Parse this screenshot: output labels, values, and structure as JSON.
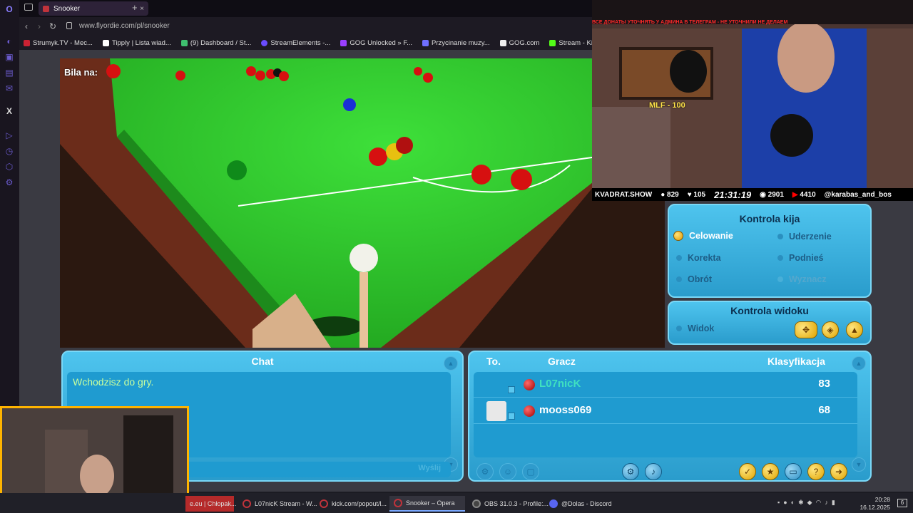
{
  "browser": {
    "tab_title": "Snooker",
    "new_tab": "+",
    "url": "www.flyordie.com/pl/snooker",
    "bookmarks": [
      "Strumyk.TV - Mec...",
      "Tipply | Lista wiad...",
      "(9) Dashboard / St...",
      "StreamElements -...",
      "GOG Unlocked » F...",
      "Przycinanie muzy...",
      "GOG.com",
      "Stream - Kick Das..."
    ]
  },
  "game": {
    "bila_label": "Bila na:",
    "cue_control": {
      "title": "Kontrola kija",
      "options": {
        "celowanie": "Celowanie",
        "uderzenie": "Uderzenie",
        "korekta": "Korekta",
        "podnies": "Podnieś",
        "obrot": "Obrót",
        "wyznacz": "Wyznacz"
      }
    },
    "view_control": {
      "title": "Kontrola widoku",
      "widok": "Widok"
    },
    "chat": {
      "title": "Chat",
      "message": "Wchodzisz do gry.",
      "send": "Wyślij"
    },
    "players": {
      "col_to": "To.",
      "col_player": "Gracz",
      "col_rank": "Klasyfikacja",
      "rows": [
        {
          "name": "L07nicK",
          "score": "83",
          "color": "#3fe0c0"
        },
        {
          "name": "mooss069",
          "score": "68",
          "color": "#ffffff"
        }
      ]
    }
  },
  "stream_overlay": {
    "red_banner": "ВСЕ ДОНАТЫ УТОЧНЯТЬ У АДМИНА В ТЕЛЕГРАМ - НЕ УТОЧНИЛИ НЕ ДЕЛАЕМ",
    "alert": "MLF - 100",
    "channel": "KVADRAT.SHOW",
    "viewers": "829",
    "likes": "105",
    "time": "21:31:19",
    "watchers": "2901",
    "yt_count": "4410",
    "handle": "@karabas_and_bos"
  },
  "taskbar": {
    "items": [
      {
        "label": "e.eu | Chłopak...",
        "color": "#c0333b"
      },
      {
        "label": "L07nicK Stream - W...",
        "color": "#c0333b"
      },
      {
        "label": "kick.com/popout/l...",
        "color": "#c0333b"
      },
      {
        "label": "Snooker – Opera",
        "color": "#c0333b"
      },
      {
        "label": "OBS 31.0.3 - Profile:...",
        "color": "#888888"
      },
      {
        "label": "@Dolas - Discord",
        "color": "#5865f2"
      }
    ],
    "time": "20:28",
    "date": "16.12.2025"
  }
}
